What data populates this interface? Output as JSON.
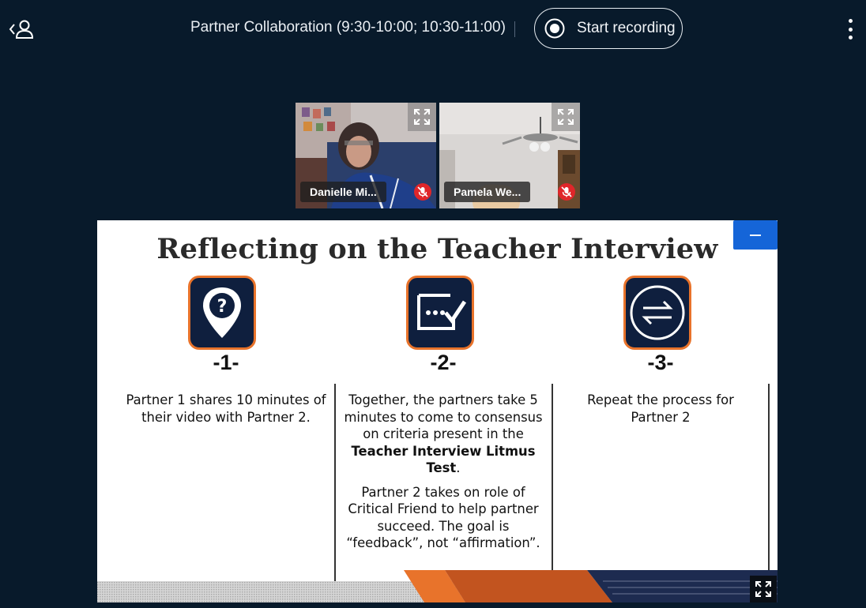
{
  "header": {
    "session_title": "Partner Collaboration (9:30-10:00; 10:30-11:00)",
    "record_label": "Start recording"
  },
  "participants": [
    {
      "name": "Danielle Mi...",
      "muted": true
    },
    {
      "name": "Pamela We...",
      "muted": true
    }
  ],
  "slide": {
    "title": "Reflecting on the Teacher Interview",
    "steps": [
      {
        "number": "-1-",
        "icon": "map-pin-question-icon",
        "text": "Partner 1 shares 10 minutes of their video with Partner 2."
      },
      {
        "number": "-2-",
        "icon": "chat-checkmark-icon",
        "text_before": "Together, the partners take 5 minutes to come to consensus on criteria present in the ",
        "text_bold": "Teacher Interview Litmus Test",
        "text_after": ".",
        "text2": "Partner 2 takes on role of Critical Friend to help partner succeed. The goal is “feedback”, not “affirmation”."
      },
      {
        "number": "-3-",
        "icon": "swap-arrows-icon",
        "text": "Repeat the process for Partner 2"
      }
    ]
  },
  "colors": {
    "background": "#081a2b",
    "accent_blue": "#1565d8",
    "icon_navy": "#0f1f3e",
    "icon_orange": "#e8732b",
    "mute_red": "#e0262a"
  }
}
